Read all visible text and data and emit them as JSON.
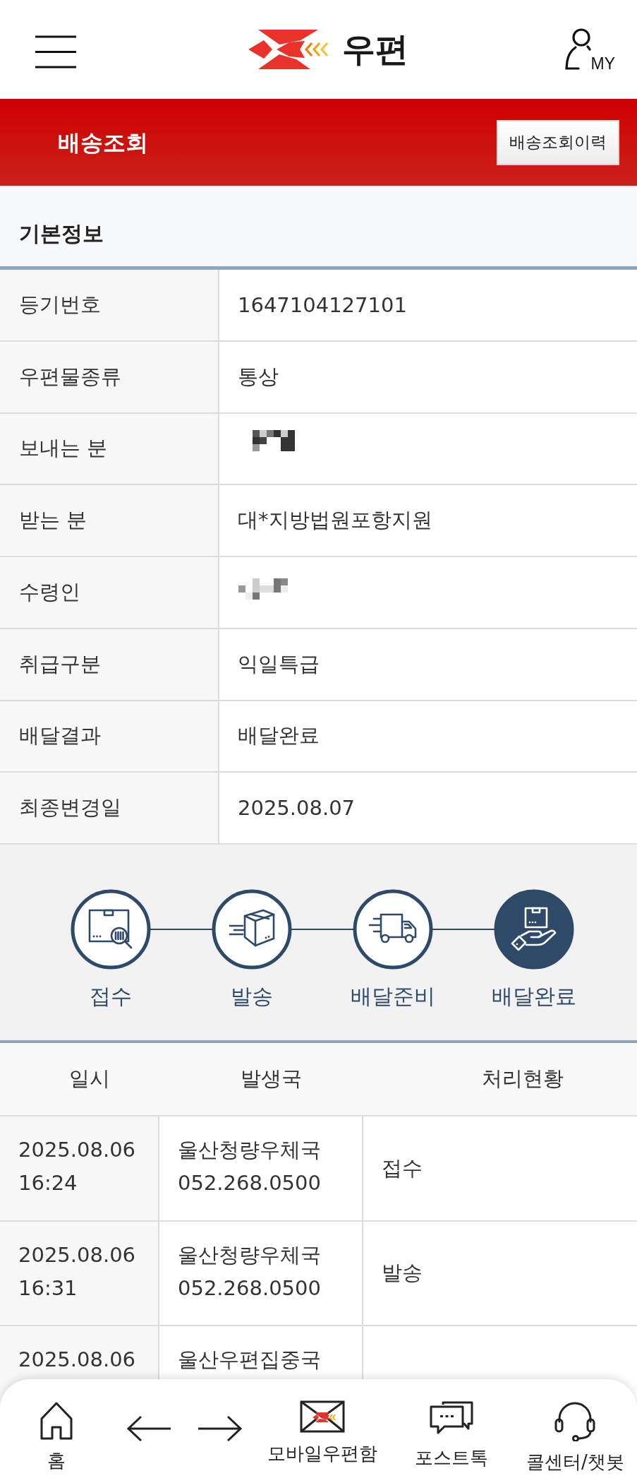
{
  "header": {
    "logo_text": "우편",
    "my_label": "MY"
  },
  "banner": {
    "title": "배송조회",
    "button": "배송조회이력"
  },
  "basic_info": {
    "title": "기본정보",
    "rows": [
      {
        "label": "등기번호",
        "kind": "text",
        "value": "1647104127101"
      },
      {
        "label": "우편물종류",
        "kind": "text",
        "value": "통상"
      },
      {
        "label": "보내는 분",
        "kind": "redacted"
      },
      {
        "label": "받는 분",
        "kind": "text",
        "value": "대*지방법원포항지원"
      },
      {
        "label": "수령인",
        "kind": "redacted"
      },
      {
        "label": "취급구분",
        "kind": "text",
        "value": "익일특급"
      },
      {
        "label": "배달결과",
        "kind": "text",
        "value": "배달완료"
      },
      {
        "label": "최종변경일",
        "kind": "text",
        "value": "2025.08.07"
      }
    ]
  },
  "progress": {
    "steps": [
      {
        "label": "접수",
        "current": false
      },
      {
        "label": "발송",
        "current": false
      },
      {
        "label": "배달준비",
        "current": false
      },
      {
        "label": "배달완료",
        "current": true
      }
    ]
  },
  "history": {
    "columns": [
      "일시",
      "발생국",
      "처리현황"
    ],
    "rows": [
      {
        "datetime": "2025.08.06\n16:24",
        "office": "울산청량우체국\n052.268.0500",
        "status": "접수"
      },
      {
        "datetime": "2025.08.06\n16:31",
        "office": "울산청량우체국\n052.268.0500",
        "status": "발송"
      },
      {
        "datetime": "2025.08.06",
        "office": "울산우편집중국"
      }
    ]
  },
  "bottom_nav": [
    {
      "kind": "link",
      "label": "홈"
    },
    {
      "kind": "arrow"
    },
    {
      "kind": "arrow"
    },
    {
      "kind": "link",
      "label": "모바일우편함"
    },
    {
      "kind": "link",
      "label": "포스트톡"
    },
    {
      "kind": "link",
      "label": "콜센터/챗봇"
    }
  ]
}
